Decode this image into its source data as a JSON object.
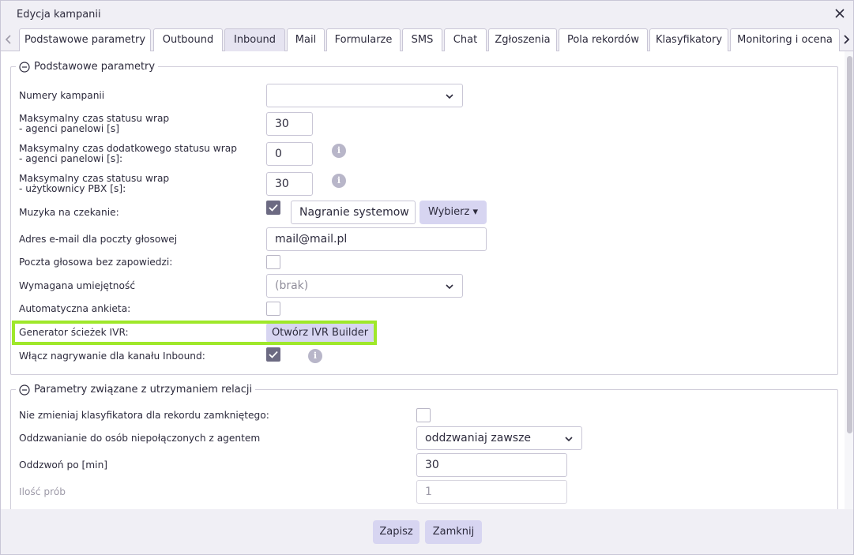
{
  "window": {
    "title": "Edycja kampanii"
  },
  "tabs": [
    {
      "label": "Podstawowe parametry"
    },
    {
      "label": "Outbound"
    },
    {
      "label": "Inbound"
    },
    {
      "label": "Mail"
    },
    {
      "label": "Formularze"
    },
    {
      "label": "SMS"
    },
    {
      "label": "Chat"
    },
    {
      "label": "Zgłoszenia"
    },
    {
      "label": "Pola rekordów"
    },
    {
      "label": "Klasyfikatory"
    },
    {
      "label": "Monitoring i ocena"
    }
  ],
  "active_tab": "Inbound",
  "basic": {
    "legend": "Podstawowe parametry",
    "campaign_numbers": {
      "label": "Numery kampanii",
      "value": ""
    },
    "wrap_panel": {
      "label_line1": "Maksymalny czas statusu wrap",
      "label_line2": "- agenci panelowi [s]",
      "value": "30"
    },
    "extra_wrap_panel": {
      "label_line1": "Maksymalny czas dodatkowego statusu wrap",
      "label_line2": "- agenci panelowi [s]:",
      "value": "0"
    },
    "wrap_pbx": {
      "label_line1": "Maksymalny czas statusu wrap",
      "label_line2": "- użytkownicy PBX [s]:",
      "value": "30"
    },
    "hold_music": {
      "label": "Muzyka na czekanie:",
      "checked": true,
      "value": "Nagranie systemow",
      "choose_label": "Wybierz ▾"
    },
    "voicemail_email": {
      "label": "Adres e-mail dla poczty głosowej",
      "value": "mail@mail.pl"
    },
    "voicemail_no_greeting": {
      "label": "Poczta głosowa bez zapowiedzi:",
      "checked": false
    },
    "required_skill": {
      "label": "Wymagana umiejętność",
      "value": "(brak)"
    },
    "auto_survey": {
      "label": "Automatyczna ankieta:",
      "checked": false
    },
    "ivr_generator": {
      "label": "Generator ścieżek IVR:",
      "button_label": "Otwórz IVR Builder"
    },
    "inbound_recording": {
      "label": "Włącz nagrywanie dla kanału Inbound:",
      "checked": true
    },
    "info_glyph": "i"
  },
  "relations": {
    "legend": "Parametry związane z utrzymaniem relacji",
    "keep_classifier": {
      "label": "Nie zmieniaj klasyfikatora dla rekordu zamkniętego:",
      "checked": false
    },
    "callback": {
      "label": "Oddzwanianie do osób niepołączonych z agentem",
      "value": "oddzwaniaj zawsze"
    },
    "callback_after": {
      "label": "Oddzwoń po [min]",
      "value": "30"
    },
    "attempts": {
      "label": "Ilość prób",
      "value": "1"
    }
  },
  "footer": {
    "save_label": "Zapisz",
    "close_label": "Zamknij"
  },
  "colors": {
    "accent_button": "#d7d5f1",
    "highlight": "#9fe82a",
    "checkbox_on": "#6c6a82"
  }
}
